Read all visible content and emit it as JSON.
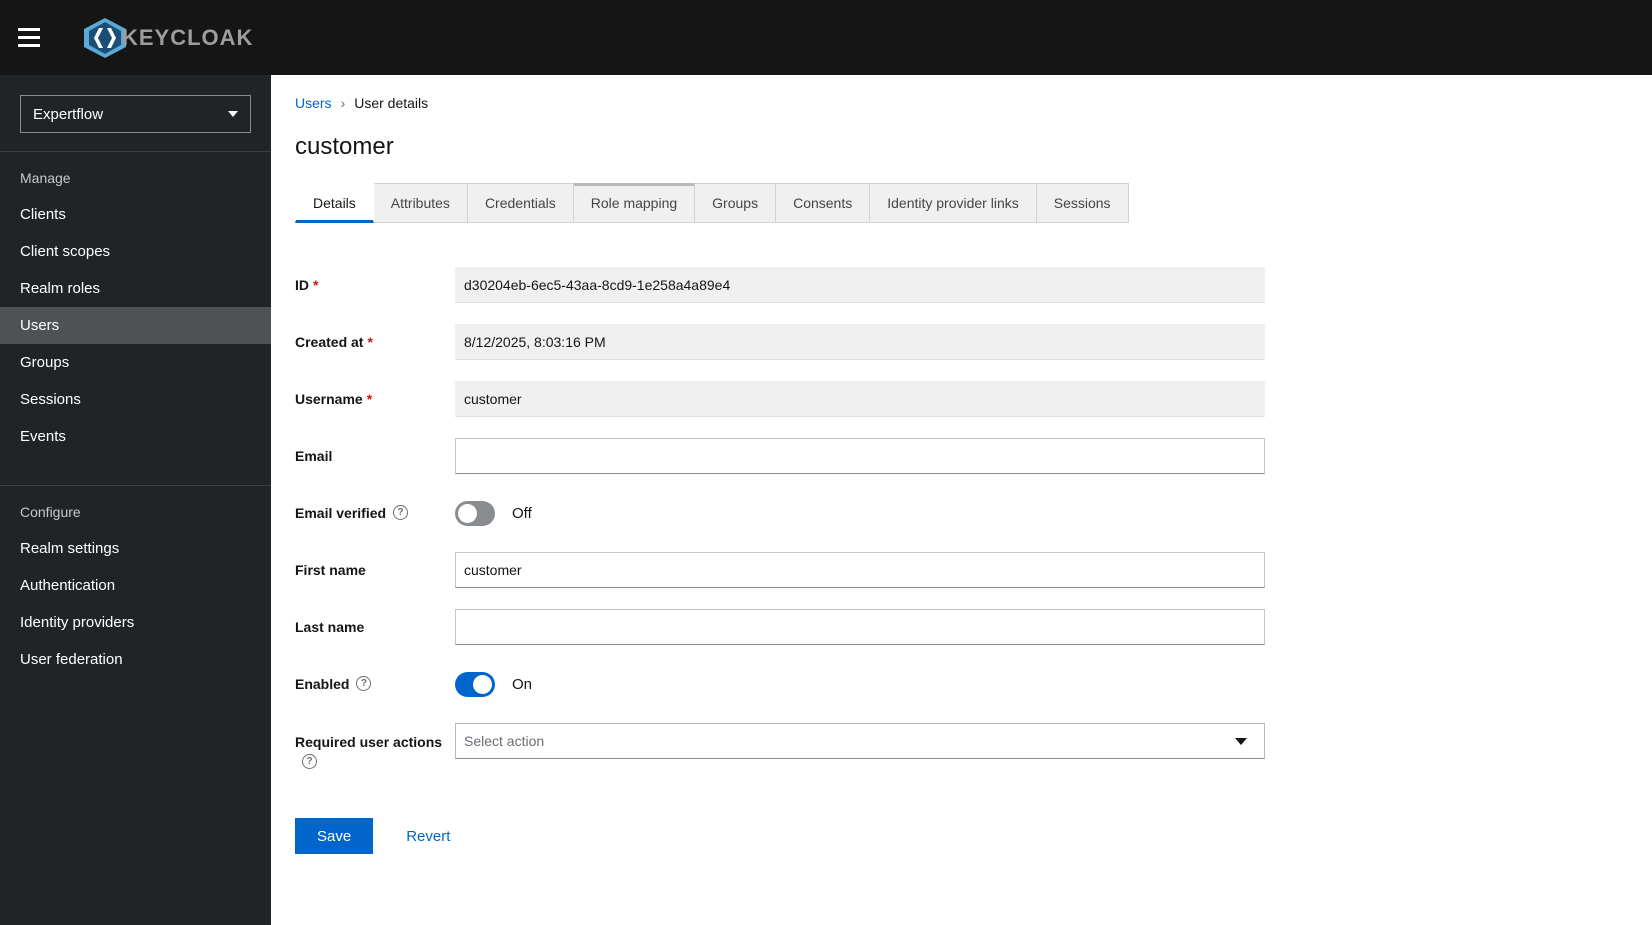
{
  "topbar": {
    "brand": "KEYCLOAK"
  },
  "sidebar": {
    "realm": "Expertflow",
    "sections": [
      {
        "label": "Manage",
        "items": [
          {
            "label": "Clients"
          },
          {
            "label": "Client scopes"
          },
          {
            "label": "Realm roles"
          },
          {
            "label": "Users"
          },
          {
            "label": "Groups"
          },
          {
            "label": "Sessions"
          },
          {
            "label": "Events"
          }
        ]
      },
      {
        "label": "Configure",
        "items": [
          {
            "label": "Realm settings"
          },
          {
            "label": "Authentication"
          },
          {
            "label": "Identity providers"
          },
          {
            "label": "User federation"
          }
        ]
      }
    ],
    "selected": "Users"
  },
  "breadcrumb": {
    "parent": "Users",
    "current": "User details"
  },
  "page_title": "customer",
  "tabs": [
    {
      "label": "Details"
    },
    {
      "label": "Attributes"
    },
    {
      "label": "Credentials"
    },
    {
      "label": "Role mapping"
    },
    {
      "label": "Groups"
    },
    {
      "label": "Consents"
    },
    {
      "label": "Identity provider links"
    },
    {
      "label": "Sessions"
    }
  ],
  "active_tab": "Details",
  "form": {
    "id": {
      "label": "ID",
      "value": "d30204eb-6ec5-43aa-8cd9-1e258a4a89e4"
    },
    "created_at": {
      "label": "Created at",
      "value": "8/12/2025, 8:03:16 PM"
    },
    "username": {
      "label": "Username",
      "value": "customer"
    },
    "email": {
      "label": "Email",
      "value": ""
    },
    "email_verified": {
      "label": "Email verified",
      "state": "Off"
    },
    "first_name": {
      "label": "First name",
      "value": "customer"
    },
    "last_name": {
      "label": "Last name",
      "value": ""
    },
    "enabled": {
      "label": "Enabled",
      "state": "On"
    },
    "required_user_actions": {
      "label": "Required user actions",
      "placeholder": "Select action"
    }
  },
  "actions": {
    "save": "Save",
    "revert": "Revert"
  },
  "colors": {
    "accent": "#0066cc",
    "danger": "#c9190b",
    "topbar": "#151515",
    "sidebar": "#212427"
  }
}
